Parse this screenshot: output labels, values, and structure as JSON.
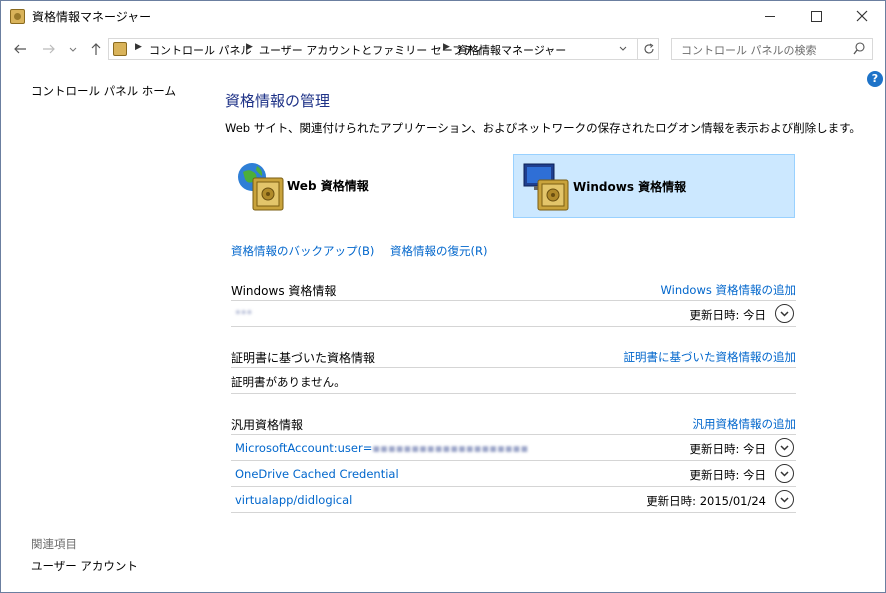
{
  "window": {
    "title": "資格情報マネージャー"
  },
  "nav": {
    "breadcrumbs": [
      "コントロール パネル",
      "ユーザー アカウントとファミリー セーフティ",
      "資格情報マネージャー"
    ],
    "search_placeholder": "コントロール パネルの検索"
  },
  "sidebar": {
    "home": "コントロール パネル ホーム",
    "related_heading": "関連項目",
    "related_items": [
      "ユーザー アカウント"
    ]
  },
  "main": {
    "title": "資格情報の管理",
    "description": "Web サイト、関連付けられたアプリケーション、およびネットワークの保存されたログオン情報を表示および削除します。",
    "cred_types": [
      {
        "label": "Web 資格情報",
        "selected": false
      },
      {
        "label": "Windows 資格情報",
        "selected": true
      }
    ],
    "links": {
      "backup": "資格情報のバックアップ(B)",
      "restore": "資格情報の復元(R)"
    },
    "sections": [
      {
        "title": "Windows 資格情報",
        "add_link": "Windows 資格情報の追加",
        "rows": [
          {
            "name": "***",
            "date": "更新日時:  今日"
          }
        ]
      },
      {
        "title": "証明書に基づいた資格情報",
        "add_link": "証明書に基づいた資格情報の追加",
        "empty_text": "証明書がありません。"
      },
      {
        "title": "汎用資格情報",
        "add_link": "汎用資格情報の追加",
        "rows": [
          {
            "name": "MicrosoftAccount:user=",
            "name_blurred": "▪▪▪▪▪▪▪▪▪▪▪▪▪▪▪▪▪▪▪▪",
            "date": "更新日時:  今日"
          },
          {
            "name": "OneDrive Cached Credential",
            "date": "更新日時:  今日"
          },
          {
            "name": "virtualapp/didlogical",
            "date": "更新日時:  2015/01/24"
          }
        ]
      }
    ]
  },
  "colors": {
    "link": "#0066cc",
    "title": "#1e3287",
    "selected_bg": "#cce8ff"
  },
  "icons": {
    "app": "vault-icon",
    "help": "help-icon",
    "web_cred": "globe-vault-icon",
    "win_cred": "monitor-vault-icon"
  }
}
